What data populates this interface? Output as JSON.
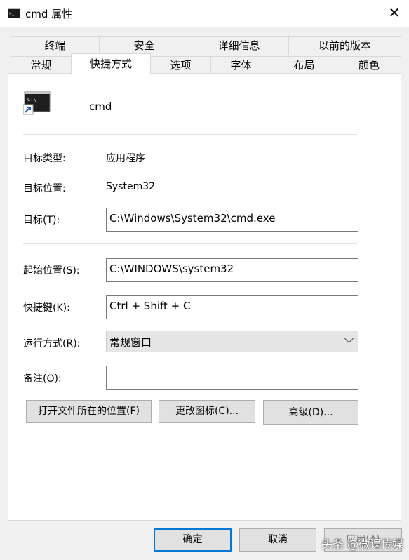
{
  "window": {
    "title": "cmd 属性",
    "close_glyph": "✕"
  },
  "tabs": {
    "row1": [
      "终端",
      "安全",
      "详细信息",
      "以前的版本"
    ],
    "row2": [
      "常规",
      "快捷方式",
      "选项",
      "字体",
      "布局",
      "颜色"
    ],
    "selected": "快捷方式"
  },
  "shortcut": {
    "name": "cmd",
    "icon": "console-shortcut-icon",
    "target_type_label": "目标类型:",
    "target_type_value": "应用程序",
    "target_location_label": "目标位置:",
    "target_location_value": "System32",
    "target_label": "目标(T):",
    "target_value": "C:\\Windows\\System32\\cmd.exe",
    "start_in_label": "起始位置(S):",
    "start_in_value": "C:\\WINDOWS\\system32",
    "hotkey_label": "快捷键(K):",
    "hotkey_value": "Ctrl + Shift + C",
    "run_label": "运行方式(R):",
    "run_value": "常规窗口",
    "comment_label": "备注(O):",
    "comment_value": ""
  },
  "buttons": {
    "open_location": "打开文件所在的位置(F)",
    "change_icon": "更改图标(C)...",
    "advanced": "高级(D)...",
    "ok": "确定",
    "cancel": "取消",
    "apply": "应用(A)"
  },
  "watermark": "头条 @微课传媒",
  "colors": {
    "background": "#f0f0f0",
    "panel": "#ffffff",
    "default_button_border": "#0078d7"
  }
}
